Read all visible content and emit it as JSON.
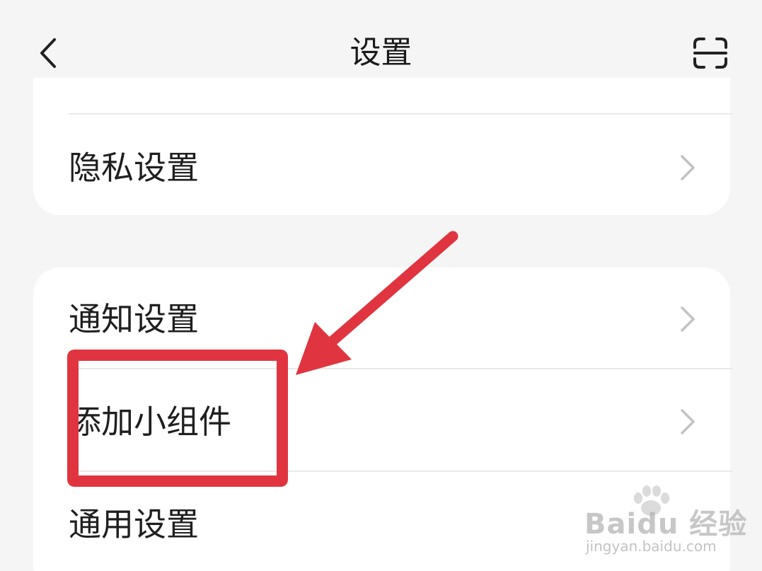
{
  "header": {
    "title": "设置",
    "back_icon": "chevron-left-icon",
    "scan_icon": "scan-icon"
  },
  "sections": [
    {
      "items": [
        {
          "label": "隐私设置",
          "icon": "chevron-right-icon"
        }
      ]
    },
    {
      "items": [
        {
          "label": "通知设置",
          "icon": "chevron-right-icon"
        },
        {
          "label": "添加小组件",
          "icon": "chevron-right-icon"
        },
        {
          "label": "通用设置",
          "icon": "chevron-right-icon"
        }
      ]
    }
  ],
  "annotation": {
    "color": "#e03540",
    "highlighted_item": "添加小组件"
  },
  "watermark": {
    "brand": "Baidu 经验",
    "url": "jingyan.baidu.com"
  },
  "colors": {
    "background": "#f5f5f5",
    "card": "#ffffff",
    "divider": "#e9e9e9",
    "chevron": "#c2c2c2"
  }
}
